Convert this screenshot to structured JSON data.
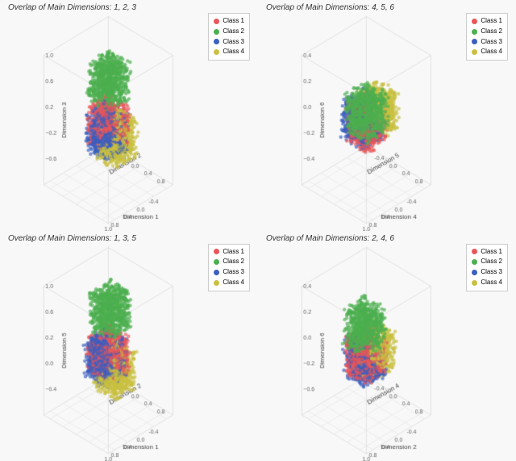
{
  "panels": [
    {
      "id": "panel-tl",
      "title": "Overlap of Main Dimensions: 1, 2, 3",
      "dim_x": "Dimension 1",
      "dim_y": "Dimension 2",
      "dim_z": "Dimension 3",
      "legend_items": [
        {
          "label": "Class 1",
          "color": "#e8565a"
        },
        {
          "label": "Class 2",
          "color": "#4caf50"
        },
        {
          "label": "Class 3",
          "color": "#3b5fc0"
        },
        {
          "label": "Class 4",
          "color": "#c9c040"
        }
      ]
    },
    {
      "id": "panel-tr",
      "title": "Overlap of Main Dimensions: 4, 5, 6",
      "dim_x": "Dimension 4",
      "dim_y": "Dimension 5",
      "dim_z": "Dimension 6",
      "legend_items": [
        {
          "label": "Class 1",
          "color": "#e8565a"
        },
        {
          "label": "Class 2",
          "color": "#4caf50"
        },
        {
          "label": "Class 3",
          "color": "#3b5fc0"
        },
        {
          "label": "Class 4",
          "color": "#c9c040"
        }
      ]
    },
    {
      "id": "panel-bl",
      "title": "Overlap of Main Dimensions: 1, 3, 5",
      "dim_x": "Dimension 1",
      "dim_y": "Dimension 2",
      "dim_z": "Dimension 5",
      "legend_items": [
        {
          "label": "Class 1",
          "color": "#e8565a"
        },
        {
          "label": "Class 2",
          "color": "#4caf50"
        },
        {
          "label": "Class 3",
          "color": "#3b5fc0"
        },
        {
          "label": "Class 4",
          "color": "#c9c040"
        }
      ]
    },
    {
      "id": "panel-br",
      "title": "Overlap of Main Dimensions: 2, 4, 6",
      "dim_x": "Dimension 2",
      "dim_y": "Dimension 4",
      "dim_z": "Dimension 6",
      "legend_items": [
        {
          "label": "Class 1",
          "color": "#e8565a"
        },
        {
          "label": "Class 2",
          "color": "#4caf50"
        },
        {
          "label": "Class 3",
          "color": "#3b5fc0"
        },
        {
          "label": "Class 4",
          "color": "#c9c040"
        }
      ]
    }
  ],
  "colors": {
    "class1": "#e8565a",
    "class2": "#4caf50",
    "class3": "#3b5fc0",
    "class4": "#c9c040"
  }
}
